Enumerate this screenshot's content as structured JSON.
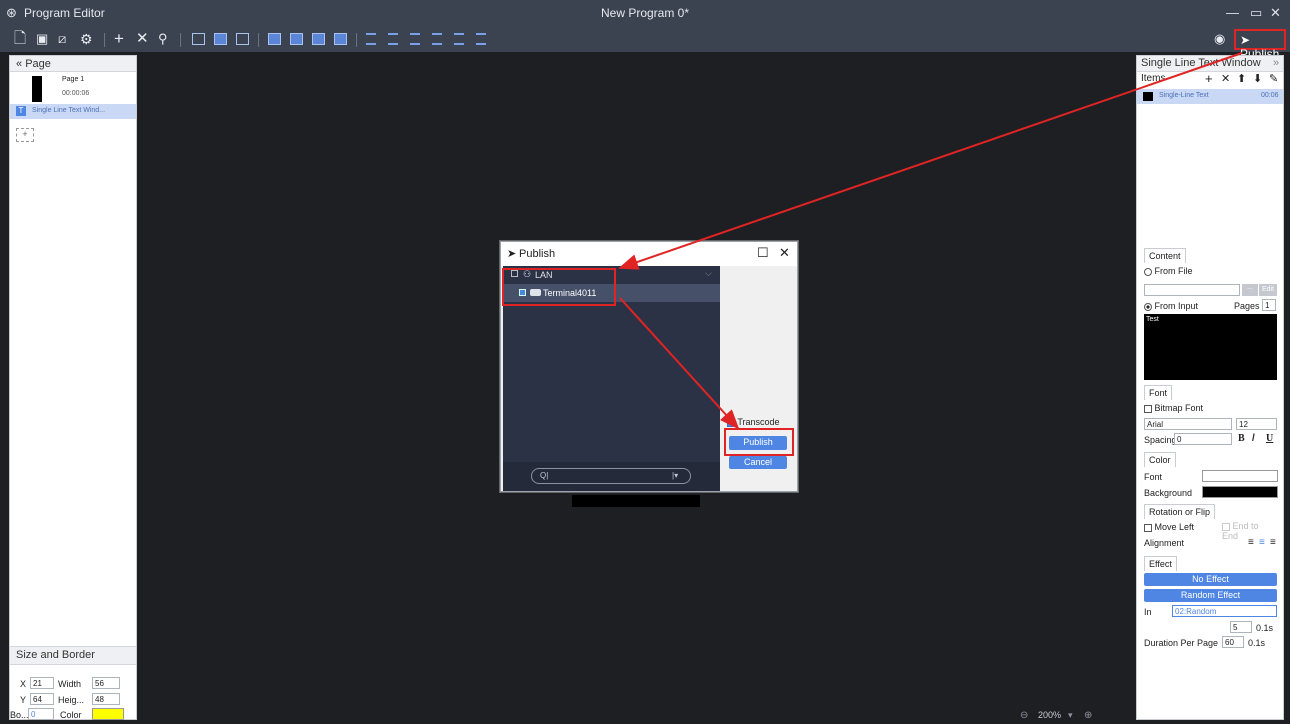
{
  "window": {
    "app_title": "Program Editor",
    "doc_title": "New Program 0*",
    "min": "—",
    "restore": "▫",
    "close": "✕"
  },
  "toolbar": {
    "publish_label": "Publish"
  },
  "page_panel": {
    "header": "Page",
    "pages": [
      {
        "name": "Page 1",
        "duration": "00:00:06"
      }
    ],
    "windows": [
      {
        "label": "Single Line Text Wind..."
      }
    ],
    "add": "+"
  },
  "size_border": {
    "header": "Size and Border",
    "x_label": "X",
    "x_value": "21",
    "width_label": "Width",
    "width_value": "56",
    "y_label": "Y",
    "y_value": "64",
    "height_label": "Heig...",
    "height_value": "48",
    "border_label": "Bo...",
    "border_value": "0",
    "color_label": "Color",
    "color_value": "#ffff00"
  },
  "canvas": {
    "zoom": "200%"
  },
  "dialog": {
    "title": "Publish",
    "lan_label": "LAN",
    "terminal_label": "Terminal4011",
    "transcode_label": "Transcode",
    "publish_btn": "Publish",
    "cancel_btn": "Cancel",
    "search_placeholder": "Q|"
  },
  "right_panel": {
    "header": "Single Line Text Window",
    "items_label": "Items",
    "items": [
      {
        "name": "Single-Line Text",
        "duration": "00:06"
      }
    ],
    "content": {
      "tab": "Content",
      "from_file": "From File",
      "edit_btn": "Edit",
      "browse_btn": "...",
      "from_input": "From Input",
      "pages_label": "Pages",
      "pages_value": "1",
      "text_value": "Test"
    },
    "font": {
      "tab": "Font",
      "bitmap_label": "Bitmap Font",
      "font_name": "Arial",
      "font_size": "12",
      "spacing_label": "Spacing",
      "spacing_value": "0",
      "bold": "B",
      "italic": "/",
      "underline": "U"
    },
    "color": {
      "tab": "Color",
      "font_label": "Font",
      "font_color": "#ffffff",
      "background_label": "Background",
      "background_color": "#000000"
    },
    "rotation": {
      "tab": "Rotation or Flip",
      "move_left": "Move Left",
      "end_to_end": "End to End",
      "alignment_label": "Alignment"
    },
    "effect": {
      "tab": "Effect",
      "no_effect": "No Effect",
      "random_effect": "Random Effect",
      "in_label": "In",
      "in_value": "02:Random",
      "speed_value": "5",
      "speed_unit": "0.1s",
      "duration_label": "Duration Per Page",
      "duration_value": "60",
      "duration_unit": "0.1s"
    }
  },
  "colors": {
    "accent": "#4f86e3",
    "annotation": "#e02424",
    "titlebar": "#3b4250"
  }
}
